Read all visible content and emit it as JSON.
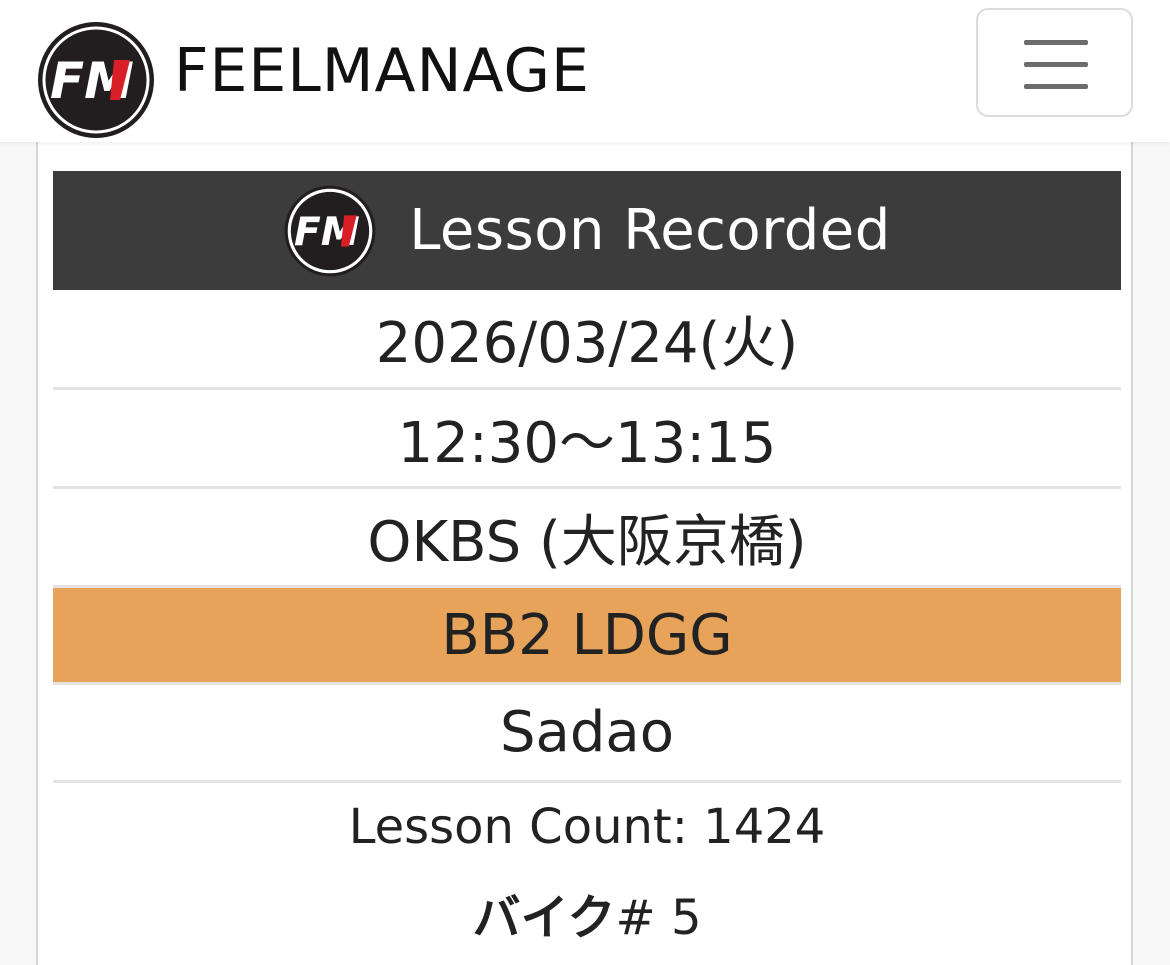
{
  "brand": {
    "logo_text": "FM",
    "name": "FEELMANAGE"
  },
  "menu": {
    "icon": "hamburger-menu-icon"
  },
  "lesson": {
    "header": "Lesson Recorded",
    "date": "2026/03/24(火)",
    "time": "12:30〜13:15",
    "location": "OKBS (大阪京橋)",
    "program": "BB2 LDGG",
    "instructor": "Sadao",
    "lesson_count": "Lesson Count: 1424",
    "bike_label": "バイク",
    "bike_number": "# 5"
  },
  "colors": {
    "header_bg": "#3c3c3c",
    "program_bg": "#e8a35a",
    "logo_red": "#d81e27",
    "logo_dark": "#221e1f"
  }
}
